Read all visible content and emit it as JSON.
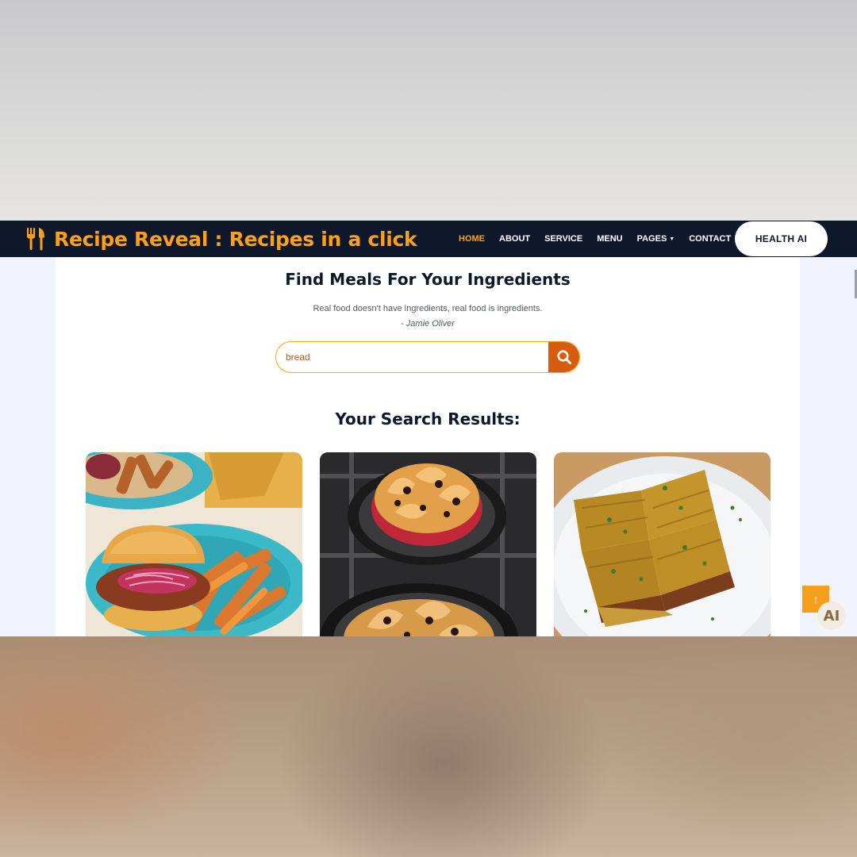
{
  "app": {
    "brand": "Recipe Reveal : Recipes in a click"
  },
  "nav": {
    "items": [
      {
        "label": "HOME",
        "active": true
      },
      {
        "label": "ABOUT",
        "active": false
      },
      {
        "label": "SERVICE",
        "active": false
      },
      {
        "label": "MENU",
        "active": false
      },
      {
        "label": "PAGES",
        "active": false,
        "dropdown": true
      },
      {
        "label": "CONTACT",
        "active": false
      }
    ],
    "cta_label": "HEALTH AI"
  },
  "hero": {
    "title": "Find Meals For Your Ingredients",
    "quote": "Real food doesn't have ingredients, real food is ingredients.",
    "author": "- Jamie Oliver"
  },
  "search": {
    "value": "bread",
    "button_icon": "search-icon"
  },
  "results": {
    "heading": "Your Search Results:",
    "cards": [
      {
        "image": "sloppy-joe-sandwich-with-sweet-potato-fries"
      },
      {
        "image": "bread-pudding-in-cast-iron-skillets"
      },
      {
        "image": "masala-bread-toast-squares"
      }
    ]
  },
  "floating": {
    "back_to_top_icon": "arrow-up-icon",
    "ai_badge": "AI"
  },
  "colors": {
    "navbar_bg": "#0f172b",
    "accent": "#fea116",
    "search_button": "#d65c10"
  }
}
